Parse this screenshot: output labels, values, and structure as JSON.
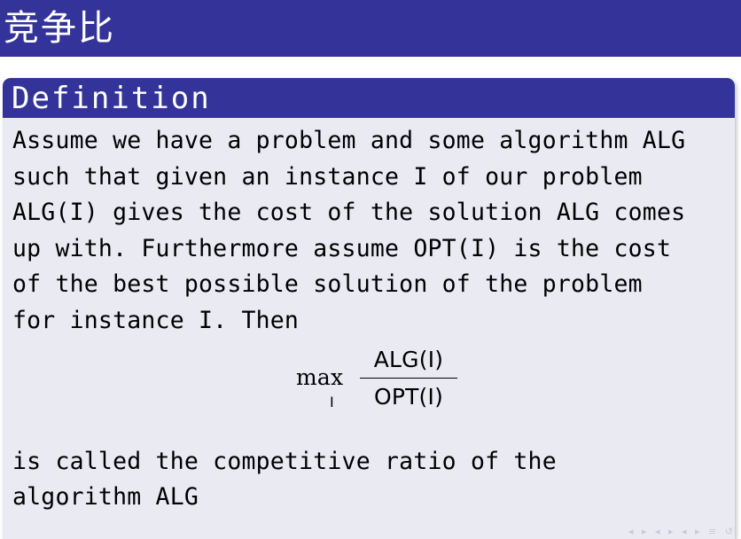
{
  "slide": {
    "title": "竞争比"
  },
  "block": {
    "title": "Definition",
    "paragraph_1": "Assume we have a problem and some algorithm ALG\nsuch that given an instance I of our problem\nALG(I) gives the cost of the solution ALG comes\nup with. Furthermore assume OPT(I) is the cost\nof the best possible solution of the problem\nfor instance I. Then",
    "formula": {
      "operator": "max",
      "subscript": "I",
      "numerator": "ALG(I)",
      "denominator": "OPT(I)"
    },
    "paragraph_2": "is called the competitive ratio of the\nalgorithm ALG"
  },
  "colors": {
    "title_bar": "#33339a",
    "block_body": "#eaeaf3",
    "text": "#000000"
  },
  "icons": [
    "beamer-navigation-icons"
  ]
}
